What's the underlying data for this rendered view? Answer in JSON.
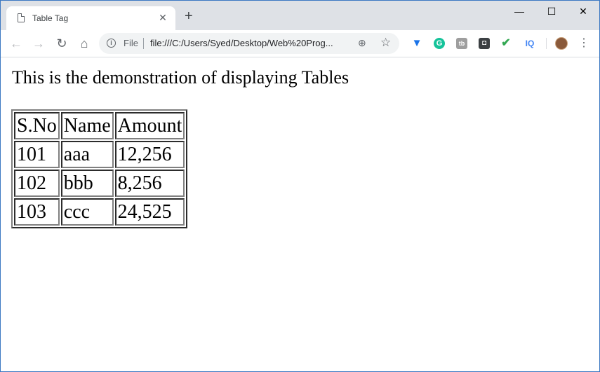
{
  "browser": {
    "tab_title": "Table Tag",
    "new_tab_symbol": "+",
    "omnibox": {
      "scheme_label": "File",
      "url": "file:///C:/Users/Syed/Desktop/Web%20Prog..."
    }
  },
  "page": {
    "heading": "This is the demonstration of displaying Tables",
    "table": {
      "headers": [
        "S.No",
        "Name",
        "Amount"
      ],
      "rows": [
        [
          "101",
          "aaa",
          "12,256"
        ],
        [
          "102",
          "bbb",
          "8,256"
        ],
        [
          "103",
          "ccc",
          "24,525"
        ]
      ]
    }
  },
  "icons": {
    "extensions": [
      "vpn-extension-icon",
      "grammarly-icon",
      "tubebuddy-icon",
      "keep-icon",
      "checkmark-extension-icon",
      "iq-extension-icon"
    ]
  },
  "colors": {
    "window_border": "#3b78c2",
    "titlebar_bg": "#dee1e6",
    "omnibox_bg": "#f1f3f4"
  }
}
